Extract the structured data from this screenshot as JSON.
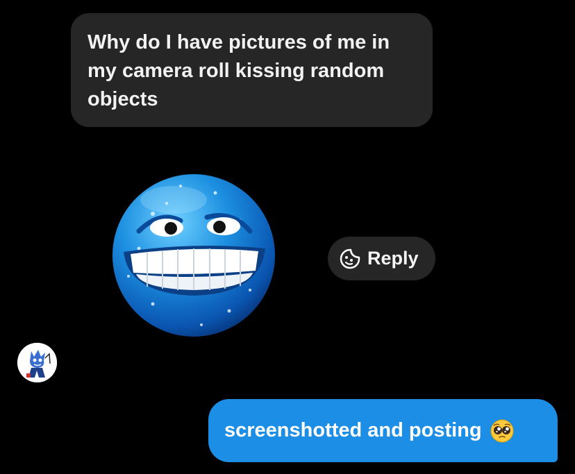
{
  "received_message": {
    "text": "Why do I have pictures of me in my camera roll kissing random objects"
  },
  "sticker": {
    "icon": "blue-grinning-sweating-face-sticker"
  },
  "reply_button": {
    "label": "Reply",
    "icon": "sticker-reply-icon"
  },
  "sender_avatar": {
    "icon": "cartoon-character-avatar"
  },
  "sent_message": {
    "text": "screenshotted and posting",
    "emoji": "pleading-face-emoji"
  },
  "colors": {
    "background": "#000000",
    "received_bubble": "#262626",
    "sent_bubble": "#1c8ee6"
  }
}
